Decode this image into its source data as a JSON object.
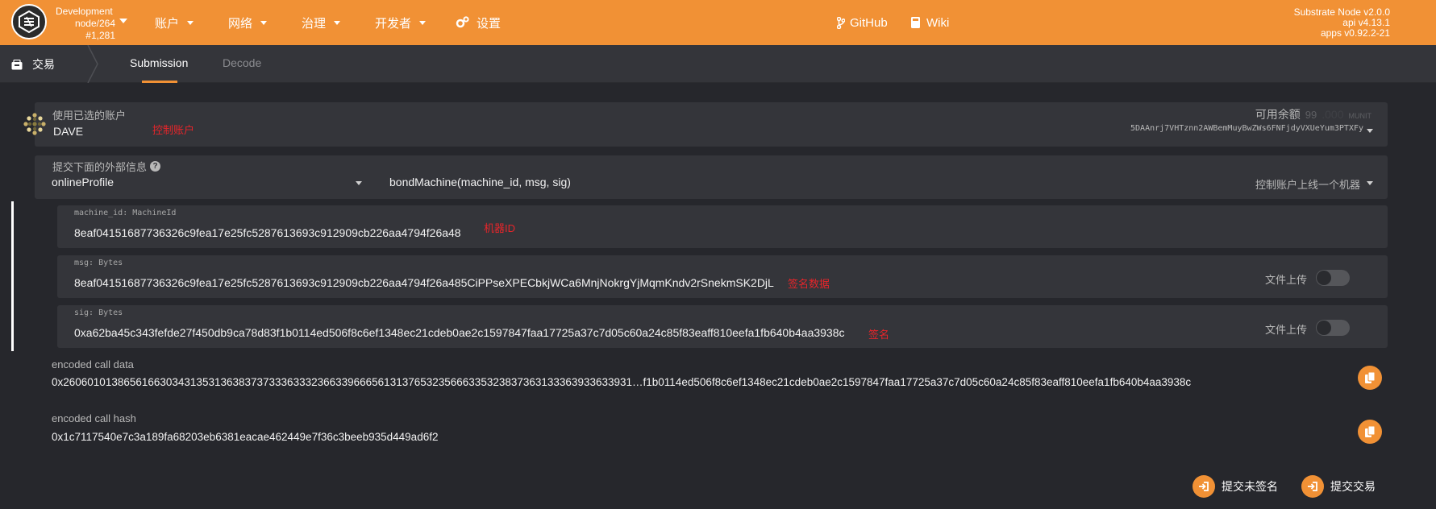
{
  "topbar": {
    "chain_name": "Development",
    "node": "node/264",
    "block": "#1,281",
    "nav": [
      "账户",
      "网络",
      "治理",
      "开发者",
      "设置"
    ],
    "links": [
      "GitHub",
      "Wiki"
    ],
    "version": {
      "node": "Substrate Node v2.0.0",
      "api": "api v4.13.1",
      "apps": "apps v0.92.2-21"
    }
  },
  "subnav": {
    "section": "交易",
    "tabs": [
      "Submission",
      "Decode"
    ]
  },
  "account": {
    "label": "使用已选的账户",
    "name": "DAVE",
    "note": "控制账户",
    "balance_label": "可用余额",
    "balance_value": "99",
    "balance_unit": "MUNIT",
    "address": "5DAAnrj7VHTznn2AWBemMuyBwZWs6FNFjdyVXUeYum3PTXFy"
  },
  "extrinsic": {
    "label": "提交下面的外部信息",
    "module": "onlineProfile",
    "method": "bondMachine(machine_id, msg, sig)",
    "method_doc": "控制账户上线一个机器"
  },
  "params": [
    {
      "label": "machine_id: MachineId",
      "value": "8eaf04151687736326c9fea17e25fc5287613693c912909cb226aa4794f26a48",
      "note": "机器ID"
    },
    {
      "label": "msg: Bytes",
      "value": "8eaf04151687736326c9fea17e25fc5287613693c912909cb226aa4794f26a485CiPPseXPECbkjWCa6MnjNokrgYjMqmKndv2rSnekmSK2DjL",
      "note": "签名数据",
      "upload_label": "文件上传"
    },
    {
      "label": "sig: Bytes",
      "value": "0xa62ba45c343fefde27f450db9ca78d83f1b0114ed506f8c6ef1348ec21cdeb0ae2c1597847faa17725a37c7d05c60a24c85f83eaff810eefa1fb640b4aa3938c",
      "note": "签名",
      "upload_label": "文件上传"
    }
  ],
  "encoded_data": {
    "label": "encoded call data",
    "value": "0x2606010138656166303431353136383737333633323663396665613137653235666335323837363133363933633931…f1b0114ed506f8c6ef1348ec21cdeb0ae2c1597847faa17725a37c7d05c60a24c85f83eaff810eefa1fb640b4aa3938c"
  },
  "encoded_hash": {
    "label": "encoded call hash",
    "value": "0x1c7117540e7c3a189fa68203eb6381eacae462449e7f36c3beeb935d449ad6f2"
  },
  "actions": {
    "unsigned": "提交未签名",
    "submit": "提交交易"
  },
  "colors": {
    "accent": "#f19135",
    "note": "#e8252a",
    "bg": "#26272c",
    "panel": "#34353a"
  }
}
